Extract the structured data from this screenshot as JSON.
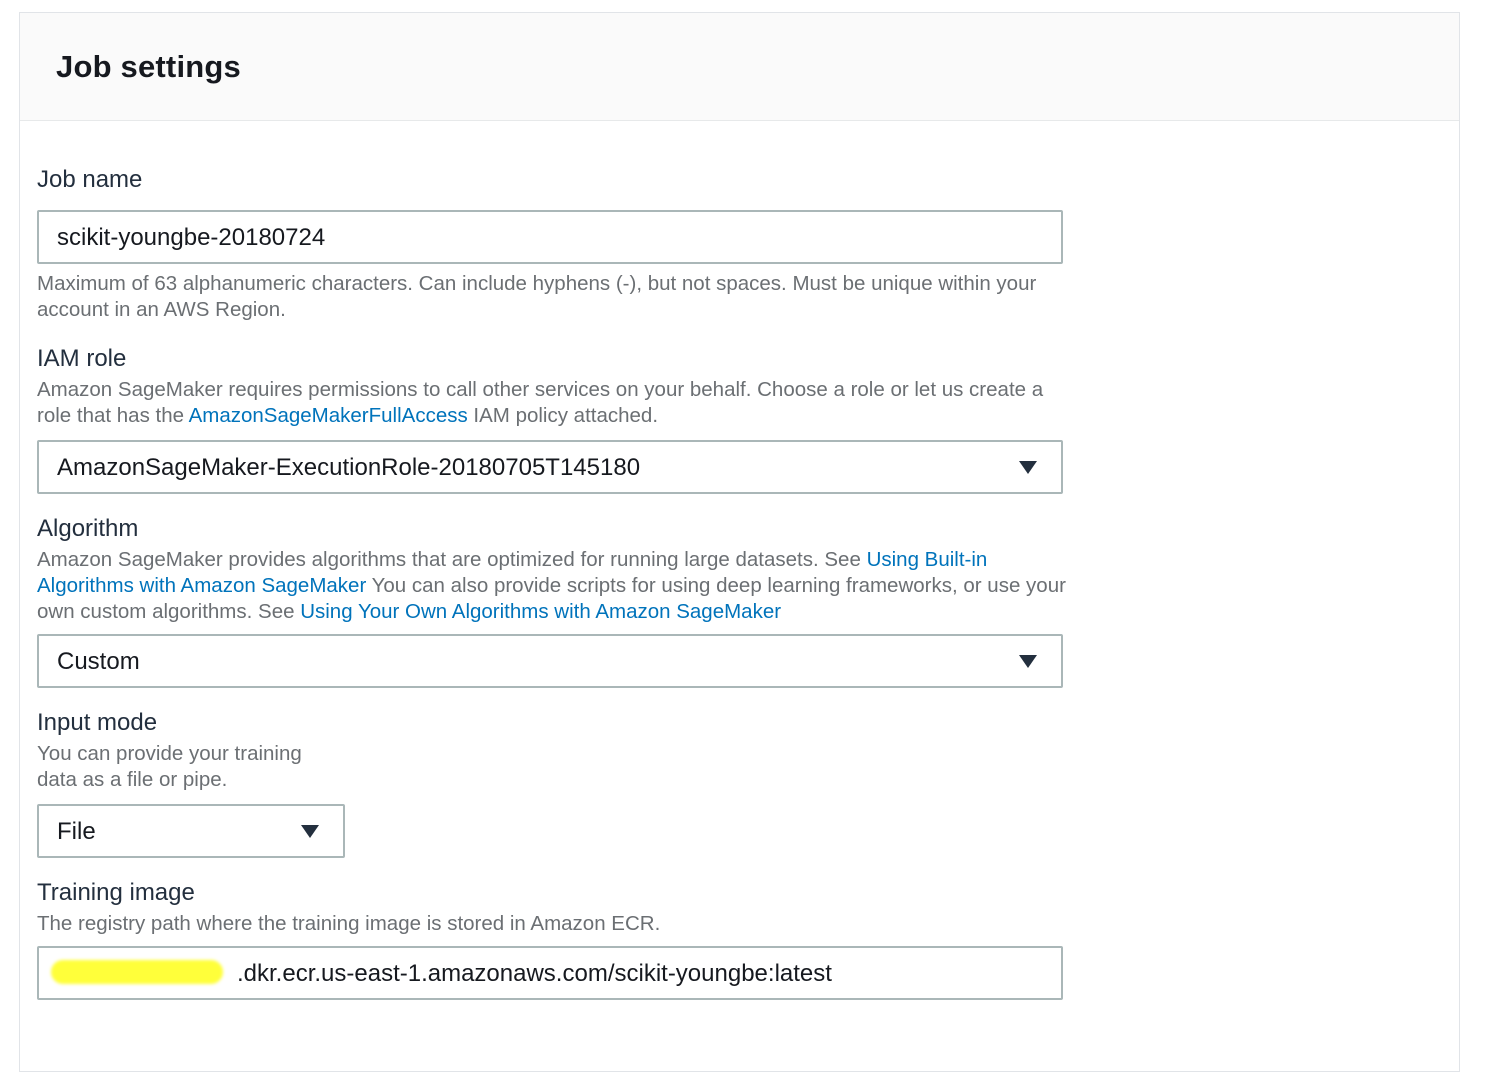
{
  "panel": {
    "title": "Job settings"
  },
  "job_name": {
    "label": "Job name",
    "value": "scikit-youngbe-20180724",
    "help": "Maximum of 63 alphanumeric characters. Can include hyphens (-), but not spaces. Must be unique within your account in an AWS Region."
  },
  "iam_role": {
    "label": "IAM role",
    "help_before": "Amazon SageMaker requires permissions to call other services on your behalf. Choose a role or let us create a role that has the ",
    "help_link": "AmazonSageMakerFullAccess",
    "help_after": " IAM policy attached.",
    "selected": "AmazonSageMaker-ExecutionRole-20180705T145180"
  },
  "algorithm": {
    "label": "Algorithm",
    "help_part1": "Amazon SageMaker provides algorithms that are optimized for running large datasets.  See ",
    "help_link1": "Using Built-in Algorithms with Amazon SageMaker",
    "help_part2": " You can also provide scripts for using deep learning frameworks, or use your own custom algorithms.  See ",
    "help_link2": "Using Your Own Algorithms with Amazon SageMaker",
    "selected": "Custom"
  },
  "input_mode": {
    "label": "Input mode",
    "help": "You can provide your training data as a file or pipe.",
    "selected": "File"
  },
  "training_image": {
    "label": "Training image",
    "help": "The registry path where the training image is stored in Amazon ECR.",
    "value": ".dkr.ecr.us-east-1.amazonaws.com/scikit-youngbe:latest"
  },
  "colors": {
    "link": "#0073bb",
    "redaction_highlight": "#ffff3a"
  },
  "icons": {
    "dropdown": "caret-down-icon"
  }
}
